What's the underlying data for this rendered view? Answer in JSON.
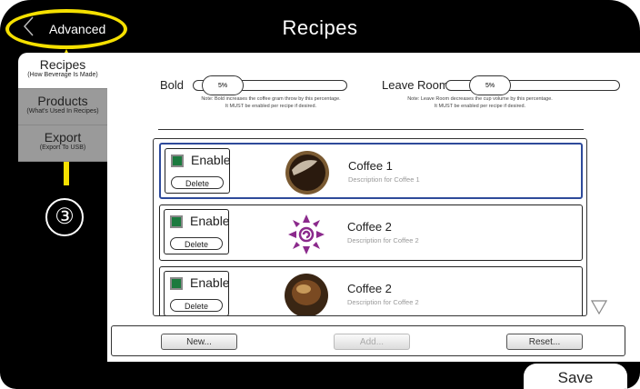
{
  "header": {
    "title": "Recipes",
    "back_label": "Advanced"
  },
  "annotation": {
    "step": "③",
    "ring_color": "#f5e000"
  },
  "sidebar": {
    "items": [
      {
        "label": "Recipes",
        "sub": "(How Beverage Is Made)"
      },
      {
        "label": "Products",
        "sub": "(What's Used In Recipes)"
      },
      {
        "label": "Export",
        "sub": "(Export To USB)"
      }
    ]
  },
  "sliders": {
    "bold": {
      "label": "Bold",
      "value": "5%",
      "note_line1": "Note: Bold increases the coffee gram throw by this percentage.",
      "note_line2": "It MUST be enabled per recipe if desired."
    },
    "leave_room": {
      "label": "Leave Room",
      "value": "5%",
      "note_line1": "Note: Leave Room decreases the cup volume by this percentage.",
      "note_line2": "It MUST be enabled per recipe if desired."
    }
  },
  "recipes": [
    {
      "enable_label": "Enable",
      "delete_label": "Delete",
      "title": "Coffee 1",
      "description": "Description for Coffee 1",
      "icon": "coffee-cup-top-icon"
    },
    {
      "enable_label": "Enable",
      "delete_label": "Delete",
      "title": "Coffee 2",
      "description": "Description for Coffee 2",
      "icon": "purple-swirl-logo-icon"
    },
    {
      "enable_label": "Enable",
      "delete_label": "Delete",
      "title": "Coffee 2",
      "description": "Description for Coffee 2",
      "icon": "coffee-glass-icon"
    }
  ],
  "actions": {
    "new_label": "New...",
    "add_label": "Add...",
    "reset_label": "Reset..."
  },
  "footer": {
    "save_label": "Save"
  },
  "colors": {
    "enable_green": "#1b7a3e",
    "selected_border": "#2e4a9a",
    "logo_purple": "#8b2a8c"
  }
}
